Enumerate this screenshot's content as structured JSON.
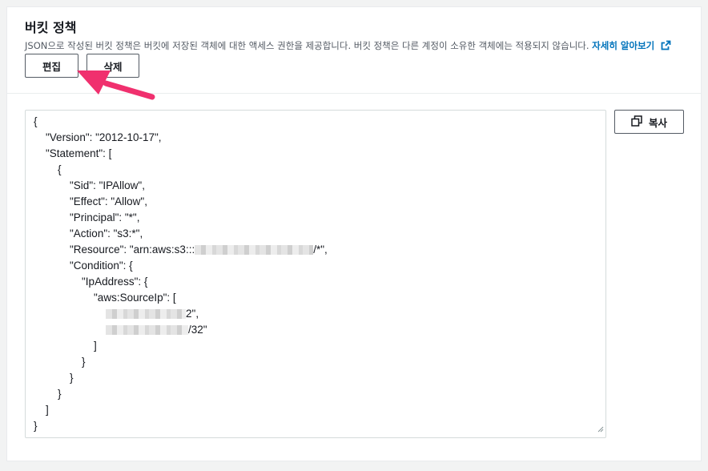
{
  "header": {
    "title": "버킷 정책",
    "description": "JSON으로 작성된 버킷 정책은 버킷에 저장된 객체에 대한 액세스 권한을 제공합니다. 버킷 정책은 다른 계정이 소유한 객체에는 적용되지 않습니다.",
    "learn_more_label": "자세히 알아보기"
  },
  "buttons": {
    "edit_label": "편집",
    "delete_label": "삭제",
    "copy_label": "복사"
  },
  "icons": {
    "external_link": "external-link-icon",
    "copy": "copy-icon",
    "resize": "resize-grip-icon"
  },
  "policy_lines": {
    "l1": "{",
    "l2": "    \"Version\": \"2012-10-17\",",
    "l3": "    \"Statement\": [",
    "l4": "        {",
    "l5": "            \"Sid\": \"IPAllow\",",
    "l6": "            \"Effect\": \"Allow\",",
    "l7": "            \"Principal\": \"*\",",
    "l8": "            \"Action\": \"s3:*\",",
    "l9_prefix": "            \"Resource\": \"arn:aws:s3:::",
    "l9_suffix": "/*\",",
    "l10": "            \"Condition\": {",
    "l11": "                \"IpAddress\": {",
    "l12": "                    \"aws:SourceIp\": [",
    "l13_prefix": "                        ",
    "l13_suffix": "2\",",
    "l14_prefix": "                        ",
    "l14_suffix": "/32\"",
    "l15": "                    ]",
    "l16": "                }",
    "l17": "            }",
    "l18": "        }",
    "l19": "    ]",
    "l20": "}"
  },
  "colors": {
    "link": "#0073bb",
    "annotation_arrow": "#f0306e",
    "border": "#545b64"
  }
}
